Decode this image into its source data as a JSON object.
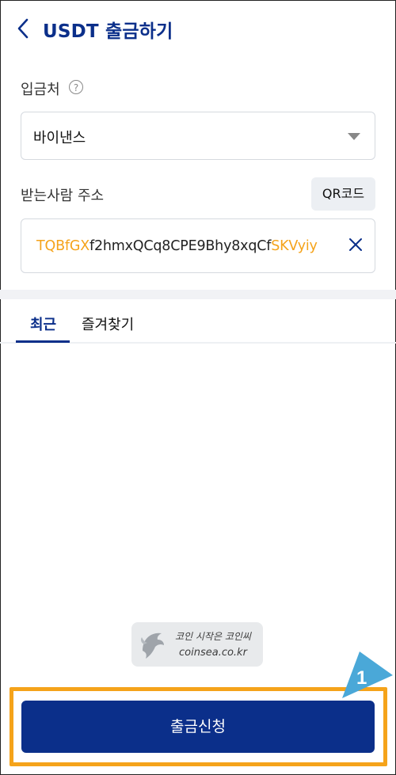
{
  "header": {
    "title": "USDT 출금하기"
  },
  "deposit_target": {
    "label": "입금처",
    "help": "?",
    "selected": "바이낸스"
  },
  "recipient": {
    "label": "받는사람 주소",
    "qr_label": "QR코드",
    "address_prefix": "TQBfGX",
    "address_middle": "f2hmxQCq8CPE9Bhy8xqCf",
    "address_suffix": "SKVyiy"
  },
  "tabs": [
    {
      "label": "최근",
      "active": true
    },
    {
      "label": "즐겨찾기",
      "active": false
    }
  ],
  "watermark": {
    "line1": "코인 시작은 코인씨",
    "line2": "coinsea.co.kr"
  },
  "submit": {
    "label": "출금신청"
  },
  "annotation": {
    "step": "1"
  },
  "colors": {
    "brand": "#0b2f8a",
    "highlight": "#f5a31a",
    "annotation": "#4aa8d8"
  }
}
